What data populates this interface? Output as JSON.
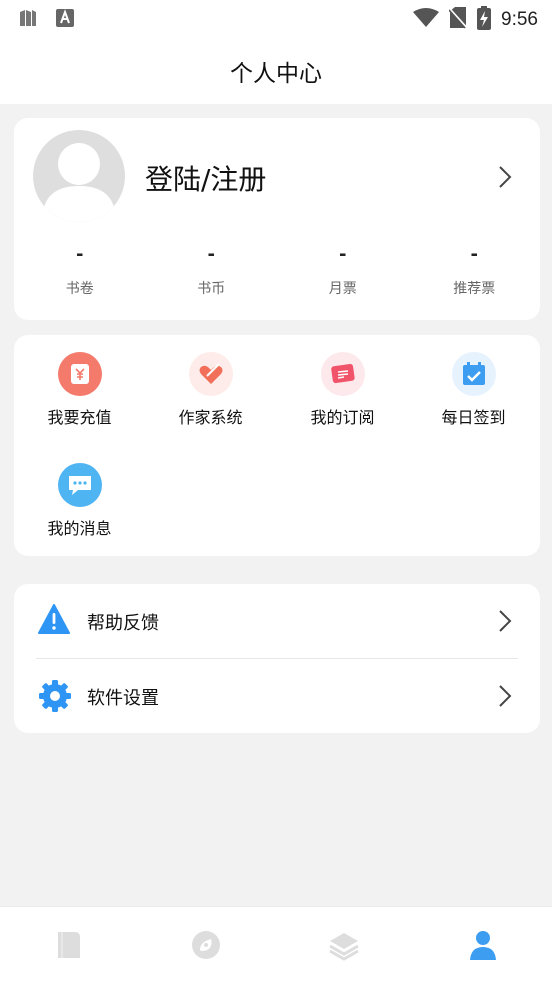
{
  "status_bar": {
    "time": "9:56",
    "icons": [
      "sim-card-icon",
      "app-notification-icon",
      "wifi-icon",
      "no-sim-icon",
      "battery-charging-icon"
    ]
  },
  "header": {
    "title": "个人中心"
  },
  "profile": {
    "login_label": "登陆/注册",
    "stats": [
      {
        "value": "-",
        "label": "书卷"
      },
      {
        "value": "-",
        "label": "书币"
      },
      {
        "value": "-",
        "label": "月票"
      },
      {
        "value": "-",
        "label": "推荐票"
      }
    ]
  },
  "services": [
    {
      "label": "我要充值",
      "icon": "wallet-recharge-icon",
      "color": "#f47a6b"
    },
    {
      "label": "作家系统",
      "icon": "writer-heart-icon",
      "color": "#f26f5a"
    },
    {
      "label": "我的订阅",
      "icon": "subscription-card-icon",
      "color": "#f0536a"
    },
    {
      "label": "每日签到",
      "icon": "calendar-check-icon",
      "color": "#3d9df0"
    },
    {
      "label": "我的消息",
      "icon": "message-bubble-icon",
      "color": "#4fb4f2"
    }
  ],
  "settings": [
    {
      "label": "帮助反馈",
      "icon": "warning-icon",
      "color": "#2f95f5"
    },
    {
      "label": "软件设置",
      "icon": "gear-icon",
      "color": "#2f95f5"
    }
  ],
  "tabbar": {
    "tabs": [
      {
        "icon": "bookshelf-icon",
        "active": false
      },
      {
        "icon": "discover-icon",
        "active": false
      },
      {
        "icon": "category-layers-icon",
        "active": false
      },
      {
        "icon": "profile-icon",
        "active": true
      }
    ],
    "active_color": "#3d9df0",
    "inactive_color": "#dddddd"
  }
}
